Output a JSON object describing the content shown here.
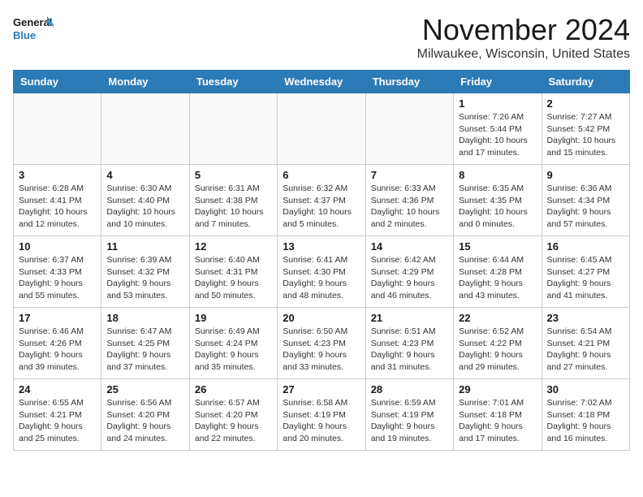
{
  "logo": {
    "line1": "General",
    "line2": "Blue"
  },
  "title": "November 2024",
  "location": "Milwaukee, Wisconsin, United States",
  "weekdays": [
    "Sunday",
    "Monday",
    "Tuesday",
    "Wednesday",
    "Thursday",
    "Friday",
    "Saturday"
  ],
  "weeks": [
    [
      {
        "day": "",
        "info": ""
      },
      {
        "day": "",
        "info": ""
      },
      {
        "day": "",
        "info": ""
      },
      {
        "day": "",
        "info": ""
      },
      {
        "day": "",
        "info": ""
      },
      {
        "day": "1",
        "info": "Sunrise: 7:26 AM\nSunset: 5:44 PM\nDaylight: 10 hours and 17 minutes."
      },
      {
        "day": "2",
        "info": "Sunrise: 7:27 AM\nSunset: 5:42 PM\nDaylight: 10 hours and 15 minutes."
      }
    ],
    [
      {
        "day": "3",
        "info": "Sunrise: 6:28 AM\nSunset: 4:41 PM\nDaylight: 10 hours and 12 minutes."
      },
      {
        "day": "4",
        "info": "Sunrise: 6:30 AM\nSunset: 4:40 PM\nDaylight: 10 hours and 10 minutes."
      },
      {
        "day": "5",
        "info": "Sunrise: 6:31 AM\nSunset: 4:38 PM\nDaylight: 10 hours and 7 minutes."
      },
      {
        "day": "6",
        "info": "Sunrise: 6:32 AM\nSunset: 4:37 PM\nDaylight: 10 hours and 5 minutes."
      },
      {
        "day": "7",
        "info": "Sunrise: 6:33 AM\nSunset: 4:36 PM\nDaylight: 10 hours and 2 minutes."
      },
      {
        "day": "8",
        "info": "Sunrise: 6:35 AM\nSunset: 4:35 PM\nDaylight: 10 hours and 0 minutes."
      },
      {
        "day": "9",
        "info": "Sunrise: 6:36 AM\nSunset: 4:34 PM\nDaylight: 9 hours and 57 minutes."
      }
    ],
    [
      {
        "day": "10",
        "info": "Sunrise: 6:37 AM\nSunset: 4:33 PM\nDaylight: 9 hours and 55 minutes."
      },
      {
        "day": "11",
        "info": "Sunrise: 6:39 AM\nSunset: 4:32 PM\nDaylight: 9 hours and 53 minutes."
      },
      {
        "day": "12",
        "info": "Sunrise: 6:40 AM\nSunset: 4:31 PM\nDaylight: 9 hours and 50 minutes."
      },
      {
        "day": "13",
        "info": "Sunrise: 6:41 AM\nSunset: 4:30 PM\nDaylight: 9 hours and 48 minutes."
      },
      {
        "day": "14",
        "info": "Sunrise: 6:42 AM\nSunset: 4:29 PM\nDaylight: 9 hours and 46 minutes."
      },
      {
        "day": "15",
        "info": "Sunrise: 6:44 AM\nSunset: 4:28 PM\nDaylight: 9 hours and 43 minutes."
      },
      {
        "day": "16",
        "info": "Sunrise: 6:45 AM\nSunset: 4:27 PM\nDaylight: 9 hours and 41 minutes."
      }
    ],
    [
      {
        "day": "17",
        "info": "Sunrise: 6:46 AM\nSunset: 4:26 PM\nDaylight: 9 hours and 39 minutes."
      },
      {
        "day": "18",
        "info": "Sunrise: 6:47 AM\nSunset: 4:25 PM\nDaylight: 9 hours and 37 minutes."
      },
      {
        "day": "19",
        "info": "Sunrise: 6:49 AM\nSunset: 4:24 PM\nDaylight: 9 hours and 35 minutes."
      },
      {
        "day": "20",
        "info": "Sunrise: 6:50 AM\nSunset: 4:23 PM\nDaylight: 9 hours and 33 minutes."
      },
      {
        "day": "21",
        "info": "Sunrise: 6:51 AM\nSunset: 4:23 PM\nDaylight: 9 hours and 31 minutes."
      },
      {
        "day": "22",
        "info": "Sunrise: 6:52 AM\nSunset: 4:22 PM\nDaylight: 9 hours and 29 minutes."
      },
      {
        "day": "23",
        "info": "Sunrise: 6:54 AM\nSunset: 4:21 PM\nDaylight: 9 hours and 27 minutes."
      }
    ],
    [
      {
        "day": "24",
        "info": "Sunrise: 6:55 AM\nSunset: 4:21 PM\nDaylight: 9 hours and 25 minutes."
      },
      {
        "day": "25",
        "info": "Sunrise: 6:56 AM\nSunset: 4:20 PM\nDaylight: 9 hours and 24 minutes."
      },
      {
        "day": "26",
        "info": "Sunrise: 6:57 AM\nSunset: 4:20 PM\nDaylight: 9 hours and 22 minutes."
      },
      {
        "day": "27",
        "info": "Sunrise: 6:58 AM\nSunset: 4:19 PM\nDaylight: 9 hours and 20 minutes."
      },
      {
        "day": "28",
        "info": "Sunrise: 6:59 AM\nSunset: 4:19 PM\nDaylight: 9 hours and 19 minutes."
      },
      {
        "day": "29",
        "info": "Sunrise: 7:01 AM\nSunset: 4:18 PM\nDaylight: 9 hours and 17 minutes."
      },
      {
        "day": "30",
        "info": "Sunrise: 7:02 AM\nSunset: 4:18 PM\nDaylight: 9 hours and 16 minutes."
      }
    ]
  ]
}
